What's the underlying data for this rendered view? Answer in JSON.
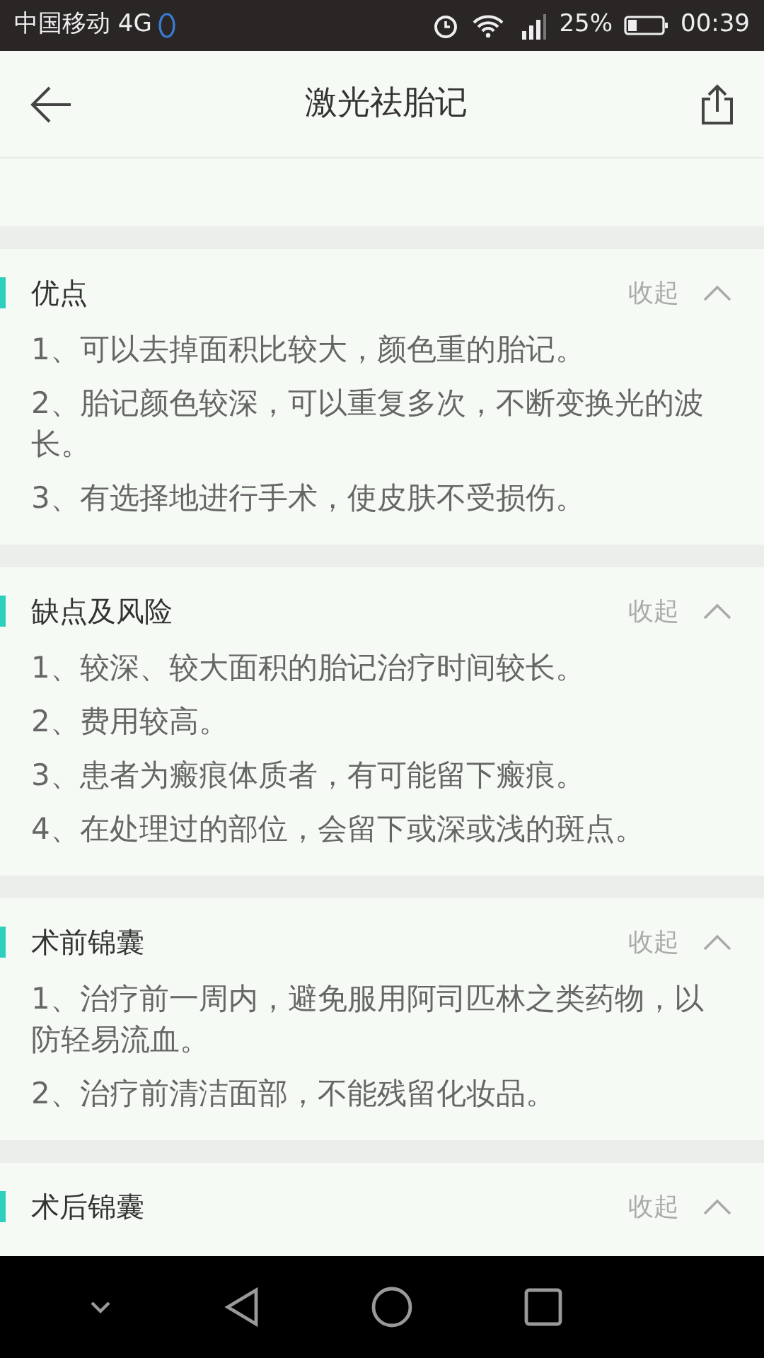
{
  "status_bar": {
    "carrier": "中国移动 4G",
    "battery": "25%",
    "time": "00:39"
  },
  "header": {
    "title": "激光祛胎记"
  },
  "sections": [
    {
      "title": "优点",
      "toggle": "收起",
      "expanded": true,
      "items": [
        "1、可以去掉面积比较大，颜色重的胎记。",
        "2、胎记颜色较深，可以重复多次，不断变换光的波长。",
        "3、有选择地进行手术，使皮肤不受损伤。"
      ]
    },
    {
      "title": "缺点及风险",
      "toggle": "收起",
      "expanded": true,
      "items": [
        "1、较深、较大面积的胎记治疗时间较长。",
        "2、费用较高。",
        "3、患者为瘢痕体质者，有可能留下瘢痕。",
        "4、在处理过的部位，会留下或深或浅的斑点。"
      ]
    },
    {
      "title": "术前锦囊",
      "toggle": "收起",
      "expanded": true,
      "items": [
        "1、治疗前一周内，避免服用阿司匹林之类药物，以防轻易流血。",
        "2、治疗前清洁面部，不能残留化妆品。"
      ]
    },
    {
      "title": "术后锦囊",
      "toggle": "收起",
      "expanded": true
    }
  ]
}
